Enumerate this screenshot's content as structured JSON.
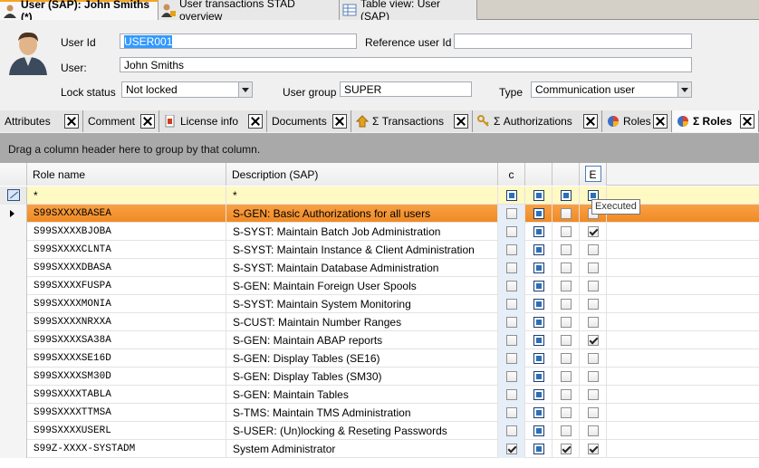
{
  "doc_tabs": [
    {
      "label": "User (SAP): John Smiths (*)",
      "active": true,
      "icon": "user-icon"
    },
    {
      "label": "User transactions STAD overview",
      "active": false,
      "icon": "user-transactions-icon"
    },
    {
      "label": "Table view: User (SAP)",
      "active": false,
      "icon": "table-icon"
    }
  ],
  "header": {
    "user_id_label": "User Id",
    "user_id_value": "USER001",
    "reference_user_label": "Reference user Id",
    "reference_user_value": "",
    "user_label": "User:",
    "user_value": "John Smiths",
    "lock_status_label": "Lock status",
    "lock_status_value": "Not locked",
    "user_group_label": "User group",
    "user_group_value": "SUPER",
    "type_label": "Type",
    "type_value": "Communication user"
  },
  "sub_tabs": [
    {
      "label": "Attributes",
      "icon": "",
      "active": false
    },
    {
      "label": "Comment",
      "icon": "",
      "active": false
    },
    {
      "label": "License info",
      "icon": "license-icon",
      "active": false
    },
    {
      "label": "Documents",
      "icon": "",
      "active": false
    },
    {
      "label": "Σ Transactions",
      "icon": "transactions-icon",
      "active": false
    },
    {
      "label": "Σ Authorizations",
      "icon": "key-icon",
      "active": false
    },
    {
      "label": "Roles",
      "icon": "pie-chart-icon",
      "active": false
    },
    {
      "label": "Σ Roles",
      "icon": "pie-chart-icon",
      "active": true
    }
  ],
  "group_panel_text": "Drag a column header here to group by that column.",
  "grid": {
    "columns": {
      "role_name": "Role name",
      "description": "Description (SAP)",
      "c": "c",
      "col4": "",
      "col5": "",
      "e": "E"
    },
    "filter_row": {
      "role_name": "*",
      "description": "*"
    },
    "tooltip": "Executed",
    "rows": [
      {
        "role": "S99SXXXXBASEA",
        "desc": "S-GEN: Basic Authorizations for all users",
        "c": false,
        "e": false,
        "col5": false,
        "selected": true
      },
      {
        "role": "S99SXXXXBJOBA",
        "desc": "S-SYST: Maintain Batch Job Administration",
        "c": false,
        "e": true,
        "col5": false,
        "selected": false
      },
      {
        "role": "S99SXXXXCLNTA",
        "desc": "S-SYST: Maintain Instance & Client Administration",
        "c": false,
        "e": false,
        "col5": false,
        "selected": false
      },
      {
        "role": "S99SXXXXDBASA",
        "desc": "S-SYST: Maintain Database Administration",
        "c": false,
        "e": false,
        "col5": false,
        "selected": false
      },
      {
        "role": "S99SXXXXFUSPA",
        "desc": "S-GEN: Maintain Foreign User Spools",
        "c": false,
        "e": false,
        "col5": false,
        "selected": false
      },
      {
        "role": "S99SXXXXMONIA",
        "desc": "S-SYST: Maintain System Monitoring",
        "c": false,
        "e": false,
        "col5": false,
        "selected": false
      },
      {
        "role": "S99SXXXXNRXXA",
        "desc": "S-CUST: Maintain Number Ranges",
        "c": false,
        "e": false,
        "col5": false,
        "selected": false
      },
      {
        "role": "S99SXXXXSA38A",
        "desc": "S-GEN: Maintain ABAP reports",
        "c": false,
        "e": true,
        "col5": false,
        "selected": false
      },
      {
        "role": "S99SXXXXSE16D",
        "desc": "S-GEN: Display Tables (SE16)",
        "c": false,
        "e": false,
        "col5": false,
        "selected": false
      },
      {
        "role": "S99SXXXXSM30D",
        "desc": "S-GEN: Display Tables (SM30)",
        "c": false,
        "e": false,
        "col5": false,
        "selected": false
      },
      {
        "role": "S99SXXXXTABLA",
        "desc": "S-GEN: Maintain Tables",
        "c": false,
        "e": false,
        "col5": false,
        "selected": false
      },
      {
        "role": "S99SXXXXTTMSA",
        "desc": "S-TMS: Maintain TMS Administration",
        "c": false,
        "e": false,
        "col5": false,
        "selected": false
      },
      {
        "role": "S99SXXXXUSERL",
        "desc": "S-USER: (Un)locking & Reseting Passwords",
        "c": false,
        "e": false,
        "col5": false,
        "selected": false
      },
      {
        "role": "S99Z-XXXX-SYSTADM",
        "desc": "System Administrator",
        "c": true,
        "e": true,
        "col5": true,
        "selected": false
      }
    ]
  },
  "colors": {
    "selected_row": "#f08a24",
    "filter_row": "#fff9c4",
    "group_panel": "#a9a9a9",
    "checkbox_fill": "#2a6fb8"
  }
}
